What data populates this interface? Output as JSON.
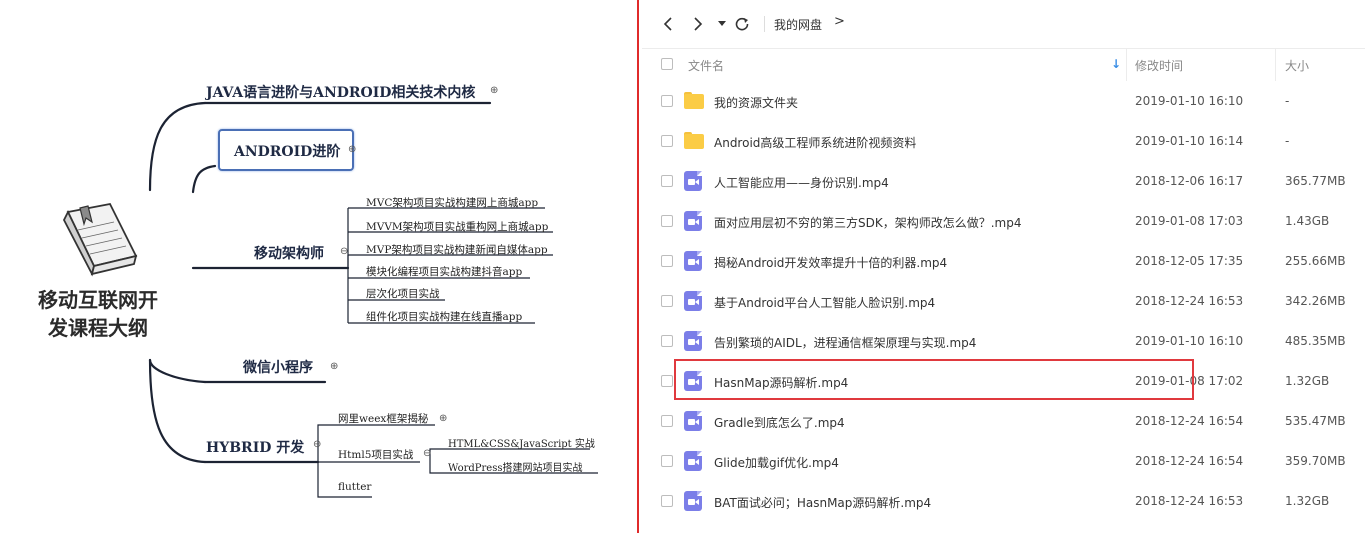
{
  "mindmap": {
    "root": {
      "line1": "移动互联网开",
      "line2": "发课程大纲"
    },
    "branches": [
      {
        "label": "JAVA语言进阶与ANDROID相关技术内核",
        "toggle": "⊕"
      },
      {
        "label": "ANDROID进阶",
        "toggle": "⊕",
        "selected": true
      },
      {
        "label": "移动架构师",
        "toggle": "⊖",
        "children": [
          "MVC架构项目实战构建网上商城app",
          "MVVM架构项目实战重构网上商城app",
          "MVP架构项目实战构建新闻自媒体app",
          "模块化编程项目实战构建抖音app",
          "层次化项目实战",
          "组件化项目实战构建在线直播app"
        ]
      },
      {
        "label": "微信小程序",
        "toggle": "⊕"
      },
      {
        "label": "HYBRID 开发",
        "toggle": "⊖",
        "children": [
          {
            "label": "网里weex框架揭秘",
            "toggle": "⊕"
          },
          {
            "label": "Html5项目实战",
            "toggle": "⊖",
            "children": [
              "HTML&CSS&JavaScript 实战",
              "WordPress搭建网站项目实战"
            ]
          },
          {
            "label": "flutter"
          }
        ]
      }
    ]
  },
  "file_manager": {
    "toolbar": {
      "back_icon": "chevron-left-icon",
      "forward_icon": "chevron-right-icon",
      "dropdown_icon": "caret-down-icon",
      "refresh_icon": "refresh-icon",
      "breadcrumb": "我的网盘",
      "breadcrumb_sep": ">"
    },
    "columns": {
      "name": "文件名",
      "sort_icon": "↓",
      "modified": "修改时间",
      "size": "大小"
    },
    "files": [
      {
        "type": "folder",
        "name": "我的资源文件夹",
        "date": "2019-01-10 16:10",
        "size": "-"
      },
      {
        "type": "folder",
        "name": "Android高级工程师系统进阶视频资料",
        "date": "2019-01-10 16:14",
        "size": "-"
      },
      {
        "type": "video",
        "name": "人工智能应用——身份识别.mp4",
        "date": "2018-12-06 16:17",
        "size": "365.77MB"
      },
      {
        "type": "video",
        "name": "面对应用层初不穷的第三方SDK，架构师改怎么做？.mp4",
        "date": "2019-01-08 17:03",
        "size": "1.43GB"
      },
      {
        "type": "video",
        "name": "揭秘Android开发效率提升十倍的利器.mp4",
        "date": "2018-12-05 17:35",
        "size": "255.66MB"
      },
      {
        "type": "video",
        "name": "基于Android平台人工智能人脸识别.mp4",
        "date": "2018-12-24 16:53",
        "size": "342.26MB"
      },
      {
        "type": "video",
        "name": "告别繁琐的AIDL，进程通信框架原理与实现.mp4",
        "date": "2019-01-10 16:10",
        "size": "485.35MB"
      },
      {
        "type": "video",
        "name": "HasnMap源码解析.mp4",
        "date": "2019-01-08 17:02",
        "size": "1.32GB",
        "highlighted": true
      },
      {
        "type": "video",
        "name": "Gradle到底怎么了.mp4",
        "date": "2018-12-24 16:54",
        "size": "535.47MB"
      },
      {
        "type": "video",
        "name": "Glide加载gif优化.mp4",
        "date": "2018-12-24 16:54",
        "size": "359.70MB"
      },
      {
        "type": "video",
        "name": "BAT面试必问；HasnMap源码解析.mp4",
        "date": "2018-12-24 16:53",
        "size": "1.32GB"
      }
    ]
  },
  "colors": {
    "divider": "#e02b2b",
    "highlight": "#e0393e",
    "folder": "#fbcc45",
    "video": "#7b7ee8",
    "selected_border": "#4a6fb5"
  }
}
